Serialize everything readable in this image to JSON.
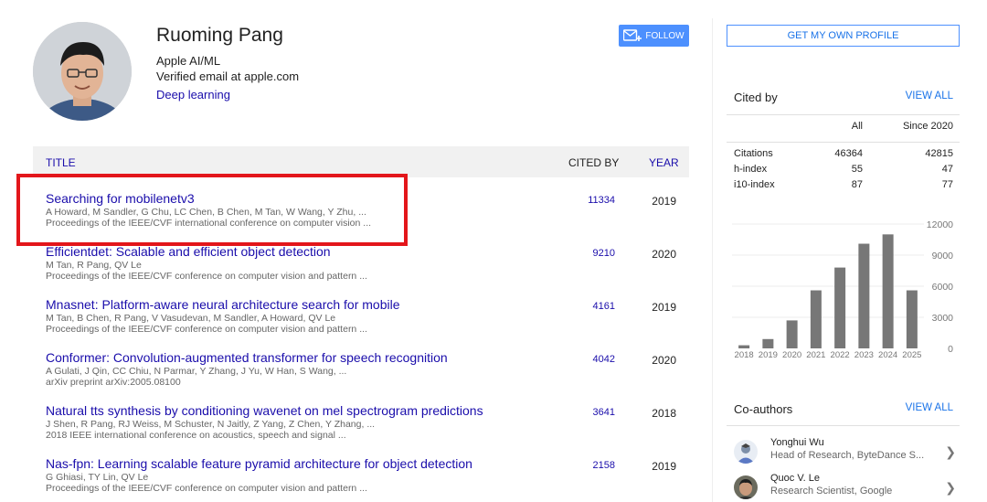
{
  "profile": {
    "name": "Ruoming Pang",
    "affiliation": "Apple AI/ML",
    "email_note": "Verified email at apple.com",
    "interest": "Deep learning",
    "follow_label": "FOLLOW"
  },
  "table": {
    "col_title": "TITLE",
    "col_cited": "CITED BY",
    "col_year": "YEAR"
  },
  "publications": [
    {
      "title": "Searching for mobilenetv3",
      "authors": "A Howard, M Sandler, G Chu, LC Chen, B Chen, M Tan, W Wang, Y Zhu, ...",
      "venue": "Proceedings of the IEEE/CVF international conference on computer vision ...",
      "cited": "11334",
      "year": "2019"
    },
    {
      "title": "Efficientdet: Scalable and efficient object detection",
      "authors": "M Tan, R Pang, QV Le",
      "venue": "Proceedings of the IEEE/CVF conference on computer vision and pattern ...",
      "cited": "9210",
      "year": "2020"
    },
    {
      "title": "Mnasnet: Platform-aware neural architecture search for mobile",
      "authors": "M Tan, B Chen, R Pang, V Vasudevan, M Sandler, A Howard, QV Le",
      "venue": "Proceedings of the IEEE/CVF conference on computer vision and pattern ...",
      "cited": "4161",
      "year": "2019"
    },
    {
      "title": "Conformer: Convolution-augmented transformer for speech recognition",
      "authors": "A Gulati, J Qin, CC Chiu, N Parmar, Y Zhang, J Yu, W Han, S Wang, ...",
      "venue": "arXiv preprint arXiv:2005.08100",
      "cited": "4042",
      "year": "2020"
    },
    {
      "title": "Natural tts synthesis by conditioning wavenet on mel spectrogram predictions",
      "authors": "J Shen, R Pang, RJ Weiss, M Schuster, N Jaitly, Z Yang, Z Chen, Y Zhang, ...",
      "venue": "2018 IEEE international conference on acoustics, speech and signal ...",
      "cited": "3641",
      "year": "2018"
    },
    {
      "title": "Nas-fpn: Learning scalable feature pyramid architecture for object detection",
      "authors": "G Ghiasi, TY Lin, QV Le",
      "venue": "Proceedings of the IEEE/CVF conference on computer vision and pattern ...",
      "cited": "2158",
      "year": "2019"
    }
  ],
  "sidebar": {
    "own_profile_label": "GET MY OWN PROFILE",
    "cited_by_title": "Cited by",
    "view_all_label": "VIEW ALL",
    "stats_header": [
      "",
      "All",
      "Since 2020"
    ],
    "stats": [
      {
        "label": "Citations",
        "all": "46364",
        "since": "42815"
      },
      {
        "label": "h-index",
        "all": "55",
        "since": "47"
      },
      {
        "label": "i10-index",
        "all": "87",
        "since": "77"
      }
    ],
    "coauthors_title": "Co-authors",
    "coauthors_view_all": "VIEW ALL",
    "coauthors": [
      {
        "name": "Yonghui Wu",
        "affiliation": "Head of Research, ByteDance S..."
      },
      {
        "name": "Quoc V. Le",
        "affiliation": "Research Scientist, Google"
      }
    ]
  },
  "chart_data": {
    "type": "bar",
    "categories": [
      "2018",
      "2019",
      "2020",
      "2021",
      "2022",
      "2023",
      "2024",
      "2025"
    ],
    "values": [
      300,
      900,
      2700,
      5600,
      7800,
      10100,
      11000,
      5600
    ],
    "yticks": [
      "0",
      "3000",
      "6000",
      "9000",
      "12000"
    ],
    "ylim": [
      0,
      12000
    ],
    "bar_color": "#777777",
    "grid": true,
    "title": "",
    "xlabel": "",
    "ylabel": ""
  },
  "colors": {
    "link": "#1a0dab",
    "accent_blue": "#4d90fe",
    "highlight_red": "#e3161b"
  }
}
